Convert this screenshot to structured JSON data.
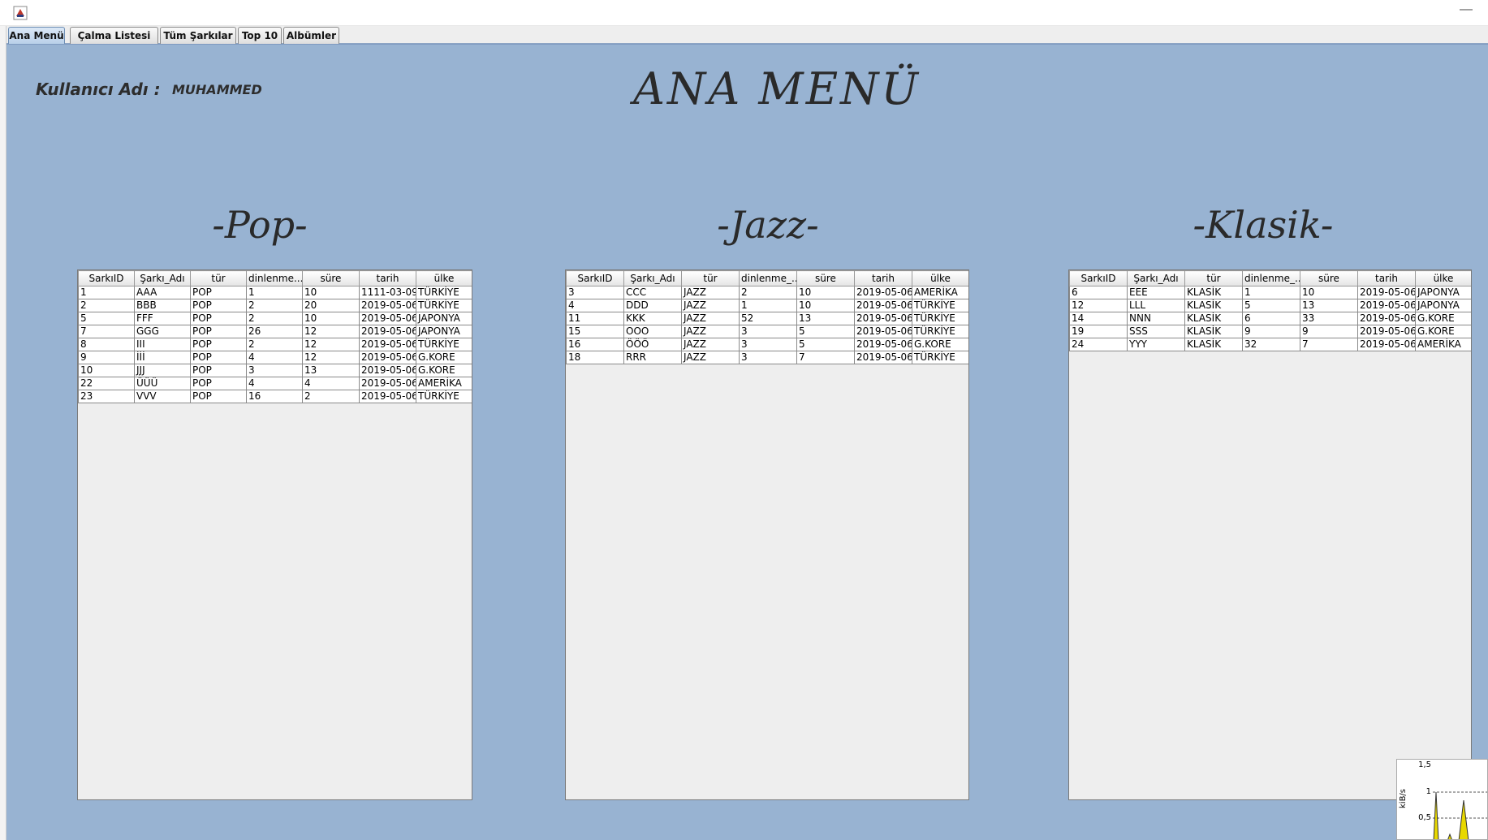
{
  "tabs": [
    {
      "label": "Ana Menü",
      "active": true
    },
    {
      "label": "Çalma Listesi",
      "active": false
    },
    {
      "label": "Tüm Şarkılar",
      "active": false
    },
    {
      "label": "Top 10",
      "active": false
    },
    {
      "label": "Albümler",
      "active": false
    }
  ],
  "window": {
    "minimize_label": "—"
  },
  "user": {
    "label": "Kullanıcı Adı :",
    "value": "MUHAMMED"
  },
  "title": "ANA MENÜ",
  "columns": [
    "SarkıID",
    "Şarkı_Adı",
    "tür",
    "dinlenme...",
    "süre",
    "tarih",
    "ülke"
  ],
  "columns_alt": [
    "SarkıID",
    "Şarkı_Adı",
    "tür",
    "dinlenme_...",
    "süre",
    "tarih",
    "ülke"
  ],
  "genres": [
    {
      "title": "-Pop-",
      "rows": [
        [
          "1",
          "AAA",
          "POP",
          "1",
          "10",
          "1111-03-09",
          "TÜRKİYE"
        ],
        [
          "2",
          "BBB",
          "POP",
          "2",
          "20",
          "2019-05-06",
          "TÜRKİYE"
        ],
        [
          "5",
          "FFF",
          "POP",
          "2",
          "10",
          "2019-05-06",
          "JAPONYA"
        ],
        [
          "7",
          "GGG",
          "POP",
          "26",
          "12",
          "2019-05-06",
          "JAPONYA"
        ],
        [
          "8",
          "III",
          "POP",
          "2",
          "12",
          "2019-05-06",
          "TÜRKİYE"
        ],
        [
          "9",
          "İİİ",
          "POP",
          "4",
          "12",
          "2019-05-06",
          "G.KORE"
        ],
        [
          "10",
          "JJJ",
          "POP",
          "3",
          "13",
          "2019-05-06",
          "G.KORE"
        ],
        [
          "22",
          "ÜÜÜ",
          "POP",
          "4",
          "4",
          "2019-05-06",
          "AMERİKA"
        ],
        [
          "23",
          "VVV",
          "POP",
          "16",
          "2",
          "2019-05-06",
          "TÜRKİYE"
        ]
      ]
    },
    {
      "title": "-Jazz-",
      "rows": [
        [
          "3",
          "CCC",
          "JAZZ",
          "2",
          "10",
          "2019-05-06",
          "AMERİKA"
        ],
        [
          "4",
          "DDD",
          "JAZZ",
          "1",
          "10",
          "2019-05-06",
          "TÜRKİYE"
        ],
        [
          "11",
          "KKK",
          "JAZZ",
          "52",
          "13",
          "2019-05-06",
          "TÜRKİYE"
        ],
        [
          "15",
          "OOO",
          "JAZZ",
          "3",
          "5",
          "2019-05-06",
          "TÜRKİYE"
        ],
        [
          "16",
          "ÖÖÖ",
          "JAZZ",
          "3",
          "5",
          "2019-05-06",
          "G.KORE"
        ],
        [
          "18",
          "RRR",
          "JAZZ",
          "3",
          "7",
          "2019-05-06",
          "TÜRKİYE"
        ]
      ]
    },
    {
      "title": "-Klasik-",
      "rows": [
        [
          "6",
          "EEE",
          "KLASİK",
          "1",
          "10",
          "2019-05-06",
          "JAPONYA"
        ],
        [
          "12",
          "LLL",
          "KLASİK",
          "5",
          "13",
          "2019-05-06",
          "JAPONYA"
        ],
        [
          "14",
          "NNN",
          "KLASİK",
          "6",
          "33",
          "2019-05-06",
          "G.KORE"
        ],
        [
          "19",
          "SSS",
          "KLASİK",
          "9",
          "9",
          "2019-05-06",
          "G.KORE"
        ],
        [
          "24",
          "YYY",
          "KLASİK",
          "32",
          "7",
          "2019-05-06",
          "AMERİKA"
        ]
      ]
    }
  ],
  "network_widget": {
    "unit": "kiB/s",
    "ticks": [
      "1,5",
      "1",
      "0,5"
    ],
    "fill_color": "#e8d800"
  },
  "colors": {
    "panel_bg": "#98b3d2",
    "active_tab": "#b8cfe8"
  }
}
